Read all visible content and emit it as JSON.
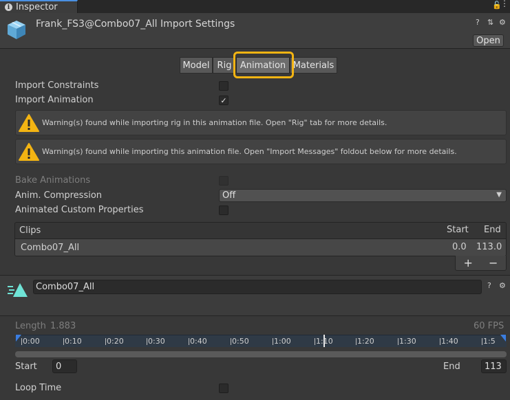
{
  "tab": {
    "title": "Inspector",
    "info_glyph": "i",
    "lock_glyph": "🔓",
    "menu_glyph": "⋮"
  },
  "header": {
    "title": "Frank_FS3@Combo07_All Import Settings",
    "open_label": "Open",
    "help_glyph": "?",
    "preset_glyph": "⇅",
    "settings_glyph": "⚙"
  },
  "toolbar": {
    "tabs": [
      {
        "label": "Model"
      },
      {
        "label": "Rig"
      },
      {
        "label": "Animation"
      },
      {
        "label": "Materials"
      }
    ]
  },
  "settings": {
    "import_constraints": {
      "label": "Import Constraints",
      "checked": false
    },
    "import_animation": {
      "label": "Import Animation",
      "checked": true,
      "check_glyph": "✓"
    },
    "warnings": [
      "Warning(s) found while importing rig in this animation file. Open \"Rig\" tab for more details.",
      "Warning(s) found while importing this animation file. Open \"Import Messages\" foldout below for more details."
    ],
    "bake_animations": {
      "label": "Bake Animations",
      "checked": false
    },
    "anim_compression": {
      "label": "Anim. Compression",
      "value": "Off",
      "arrow": "▼"
    },
    "animated_custom_properties": {
      "label": "Animated Custom Properties",
      "checked": false
    }
  },
  "clips": {
    "header": {
      "name": "Clips",
      "start": "Start",
      "end": "End"
    },
    "rows": [
      {
        "name": "Combo07_All",
        "start": "0.0",
        "end": "113.0"
      }
    ],
    "add_glyph": "+",
    "remove_glyph": "−"
  },
  "clip": {
    "name": "Combo07_All",
    "length_label": "Length",
    "length_value": "1.883",
    "fps": "60 FPS",
    "ticks": [
      "0:00",
      "0:10",
      "0:20",
      "0:30",
      "0:40",
      "0:50",
      "1:00",
      "1:10",
      "1:20",
      "1:30",
      "1:40",
      "1:5"
    ],
    "start_label": "Start",
    "start_value": "0",
    "end_label": "End",
    "end_value": "113",
    "loop_time_label": "Loop Time"
  },
  "colors": {
    "accent_highlight": "#f3b413",
    "warning": "#f3b413",
    "clip_icon": "#6fe3d6",
    "background": "#383838"
  }
}
